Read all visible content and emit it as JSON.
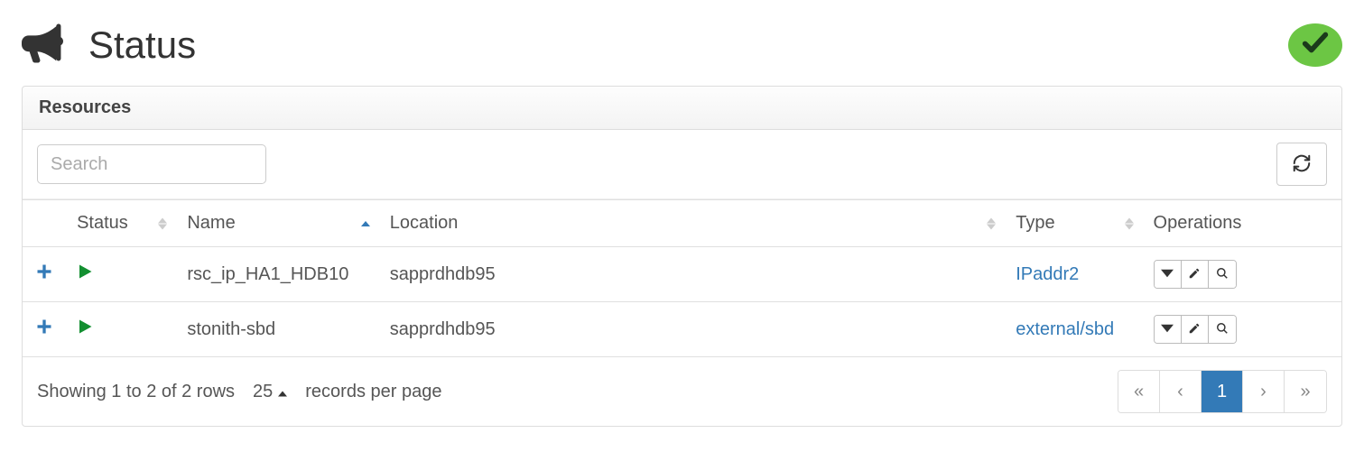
{
  "header": {
    "title": "Status"
  },
  "panel": {
    "heading": "Resources",
    "search_placeholder": "Search",
    "columns": {
      "status": "Status",
      "name": "Name",
      "location": "Location",
      "type": "Type",
      "operations": "Operations"
    },
    "rows": [
      {
        "name": "rsc_ip_HA1_HDB10",
        "location": "sapprdhdb95",
        "type": "IPaddr2"
      },
      {
        "name": "stonith-sbd",
        "location": "sapprdhdb95",
        "type": "external/sbd"
      }
    ],
    "footer": {
      "summary": "Showing 1 to 2 of 2 rows",
      "page_size": "25",
      "records_label": "records per page",
      "current_page": "1"
    }
  }
}
